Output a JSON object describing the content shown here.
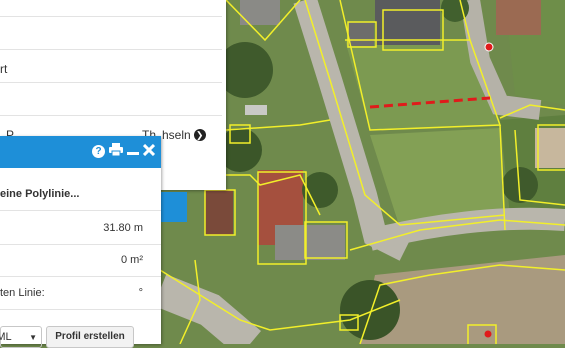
{
  "side_panel": {
    "row2_text": "rt",
    "partial_label_left": "P",
    "partial_label_mid": "Th",
    "swap_label": "hseln"
  },
  "tool": {
    "title": "eine Polylinie...",
    "rows": [
      {
        "label": "",
        "value": "31.80 m"
      },
      {
        "label": "",
        "value": "0 m²"
      },
      {
        "label": "ten Linie:",
        "value": "°"
      }
    ],
    "format_select": "KML",
    "profile_button": "Profil erstellen"
  },
  "colors": {
    "accent": "#1e8fd8",
    "parcel_line": "#f2ef2a",
    "measure_line": "#e01b1b"
  },
  "icons": [
    "help-icon",
    "print-icon",
    "minimize-icon",
    "close-icon",
    "chevron-right-icon"
  ]
}
